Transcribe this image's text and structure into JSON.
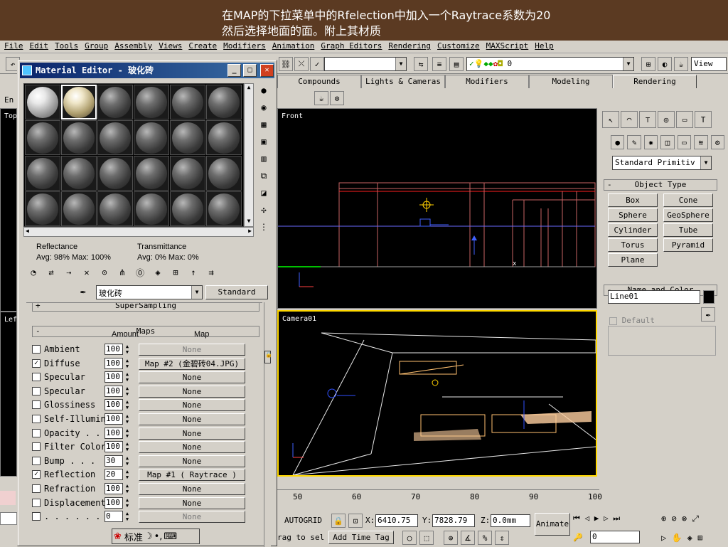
{
  "banner": {
    "line1": "在MAP的下拉菜单中的Rfelection中加入一个Raytrace系数为20",
    "line2": "然后选择地面的面。附上其材质"
  },
  "menu": [
    "File",
    "Edit",
    "Tools",
    "Group",
    "Assembly",
    "Views",
    "Create",
    "Modifiers",
    "Animation",
    "Graph Editors",
    "Rendering",
    "Customize",
    "MAXScript",
    "Help"
  ],
  "toolbar": {
    "selection_set": "",
    "layer": "0",
    "view_dropdown": "View"
  },
  "tabs": [
    "Compounds",
    "Lights & Cameras",
    "Modifiers",
    "Modeling",
    "Rendering"
  ],
  "active_tab": "Rendering",
  "viewports": {
    "top": "Top",
    "front": "Front",
    "left": "Left",
    "camera": "Camera01"
  },
  "command_panel": {
    "category": "Standard Primitiv",
    "object_type_title": "Object Type",
    "buttons": [
      "Box",
      "Cone",
      "Sphere",
      "GeoSphere",
      "Cylinder",
      "Tube",
      "Torus",
      "Pyramid",
      "Plane"
    ],
    "name_color_title": "Name and Color",
    "object_name": "Line01",
    "default_label": "Default"
  },
  "material_editor": {
    "title": "Material Editor - 玻化砖",
    "reflectance_label": "Reflectance",
    "reflectance_value": "Avg:  98% Max: 100%",
    "transmittance_label": "Transmittance",
    "transmittance_value": "Avg:   0% Max:   0%",
    "material_name": "玻化砖",
    "material_type": "Standard",
    "supersampling": "SuperSampling",
    "maps_title": "Maps",
    "col_amount": "Amount",
    "col_map": "Map",
    "maps": [
      {
        "name": "Ambient",
        "checked": false,
        "amount": "100",
        "map": "None",
        "none": true
      },
      {
        "name": "Diffuse",
        "checked": true,
        "amount": "100",
        "map": "Map #2 (金碧砖04.JPG)",
        "none": false
      },
      {
        "name": "Specular",
        "checked": false,
        "amount": "100",
        "map": "None",
        "none": false
      },
      {
        "name": "Specular",
        "checked": false,
        "amount": "100",
        "map": "None",
        "none": false
      },
      {
        "name": "Glossiness",
        "checked": false,
        "amount": "100",
        "map": "None",
        "none": false
      },
      {
        "name": "Self-Illumin",
        "checked": false,
        "amount": "100",
        "map": "None",
        "none": false
      },
      {
        "name": "Opacity . .",
        "checked": false,
        "amount": "100",
        "map": "None",
        "none": false
      },
      {
        "name": "Filter Color",
        "checked": false,
        "amount": "100",
        "map": "None",
        "none": false
      },
      {
        "name": "Bump  . . .",
        "checked": false,
        "amount": "30",
        "map": "None",
        "none": false
      },
      {
        "name": "Reflection",
        "checked": true,
        "amount": "20",
        "map": "Map #1  ( Raytrace )",
        "none": false
      },
      {
        "name": "Refraction",
        "checked": false,
        "amount": "100",
        "map": "None",
        "none": false
      },
      {
        "name": "Displacement",
        "checked": false,
        "amount": "100",
        "map": "None",
        "none": false
      },
      {
        "name": ". . . . . .",
        "checked": false,
        "amount": "0",
        "map": "None",
        "none": true
      }
    ]
  },
  "ime": {
    "label": "标准"
  },
  "timeline": {
    "ticks": [
      "50",
      "60",
      "70",
      "80",
      "90",
      "100"
    ]
  },
  "status": {
    "autogrid": "AUTOGRID",
    "x": "6410.75",
    "y": "7828.79",
    "z": "0.0mm",
    "drag_hint": "rag to sel",
    "add_time_tag": "Add Time Tag",
    "animate": "Animate",
    "frame": "0"
  }
}
